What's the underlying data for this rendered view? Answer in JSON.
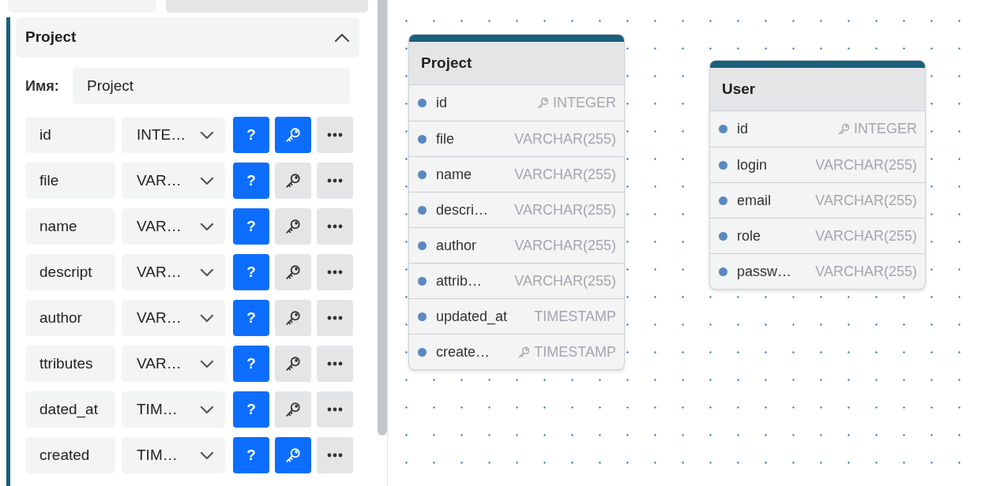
{
  "editor": {
    "title": "Project",
    "expanded": true,
    "name_label": "Имя:",
    "name_value": "Project",
    "fields": [
      {
        "name": "id",
        "type": "INTE…",
        "help": "?",
        "primary_key": true
      },
      {
        "name": "file",
        "type": "VAR…",
        "help": "?",
        "primary_key": false
      },
      {
        "name": "name",
        "type": "VAR…",
        "help": "?",
        "primary_key": false
      },
      {
        "name": "descript",
        "type": "VAR…",
        "help": "?",
        "primary_key": false
      },
      {
        "name": "author",
        "type": "VAR…",
        "help": "?",
        "primary_key": false
      },
      {
        "name": "ttributes",
        "type": "VAR…",
        "help": "?",
        "primary_key": false
      },
      {
        "name": "dated_at",
        "type": "TIM…",
        "help": "?",
        "primary_key": false
      },
      {
        "name": "created",
        "type": "TIM…",
        "help": "?",
        "primary_key": true
      }
    ]
  },
  "diagram": {
    "tables": [
      {
        "title": "Project",
        "columns": [
          {
            "name": "id",
            "type": "INTEGER",
            "primary_key": true
          },
          {
            "name": "file",
            "type": "VARCHAR(255)",
            "primary_key": false
          },
          {
            "name": "name",
            "type": "VARCHAR(255)",
            "primary_key": false
          },
          {
            "name": "descri…",
            "type": "VARCHAR(255)",
            "primary_key": false
          },
          {
            "name": "author",
            "type": "VARCHAR(255)",
            "primary_key": false
          },
          {
            "name": "attrib…",
            "type": "VARCHAR(255)",
            "primary_key": false
          },
          {
            "name": "updated_at",
            "type": "TIMESTAMP",
            "primary_key": false
          },
          {
            "name": "create…",
            "type": "TIMESTAMP",
            "primary_key": true
          }
        ]
      },
      {
        "title": "User",
        "columns": [
          {
            "name": "id",
            "type": "INTEGER",
            "primary_key": true
          },
          {
            "name": "login",
            "type": "VARCHAR(255)",
            "primary_key": false
          },
          {
            "name": "email",
            "type": "VARCHAR(255)",
            "primary_key": false
          },
          {
            "name": "role",
            "type": "VARCHAR(255)",
            "primary_key": false
          },
          {
            "name": "passw…",
            "type": "VARCHAR(255)",
            "primary_key": false
          }
        ]
      }
    ]
  }
}
